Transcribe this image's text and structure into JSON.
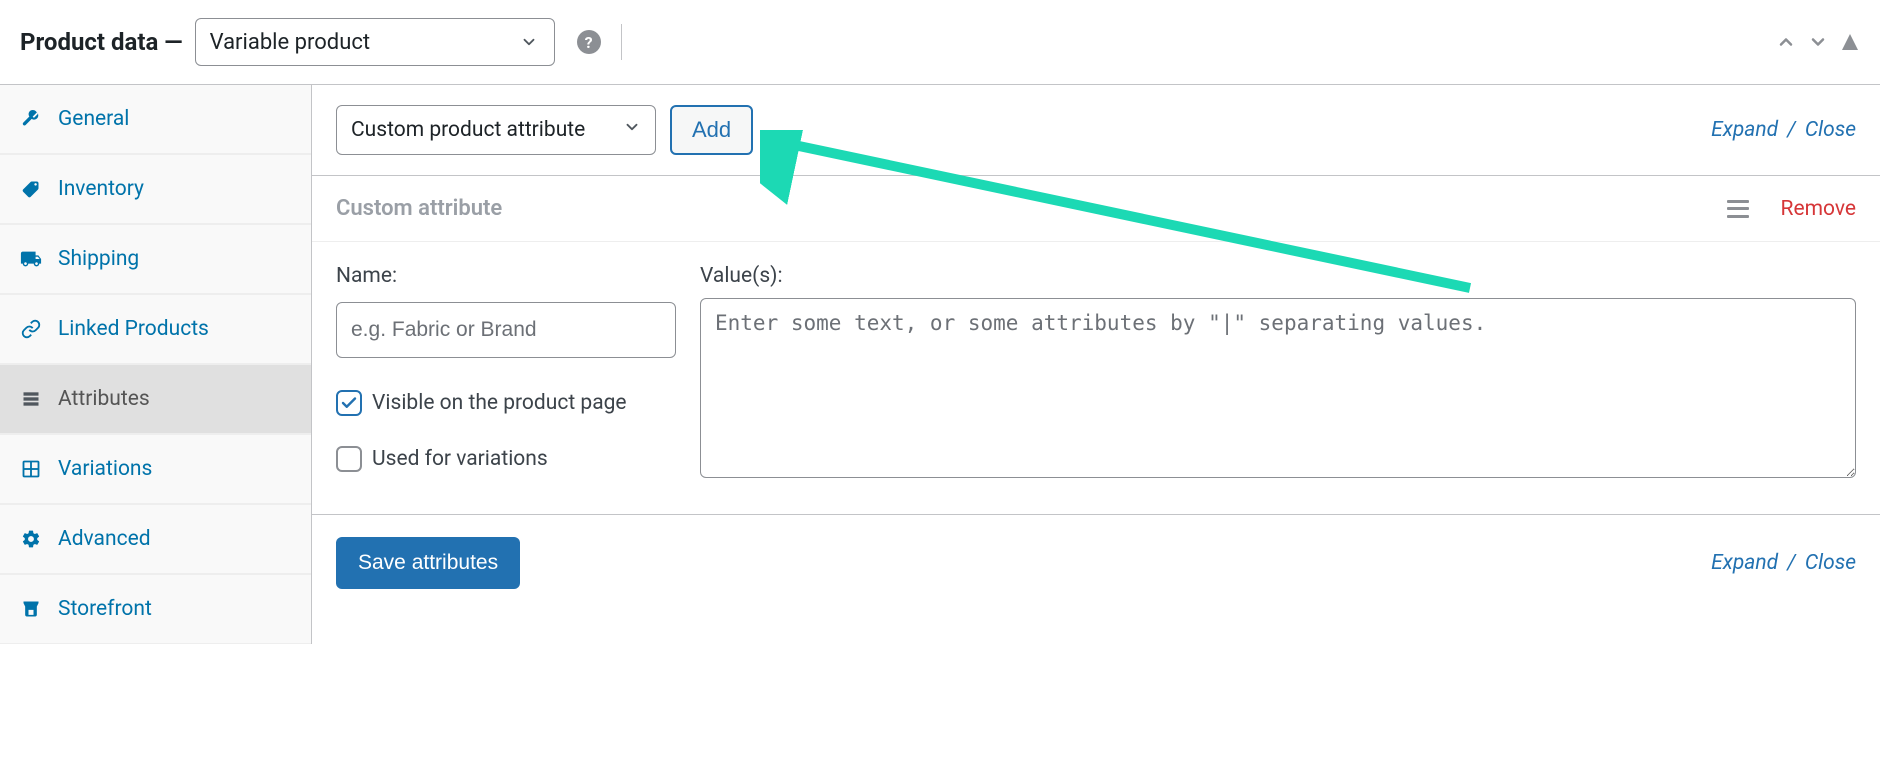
{
  "header": {
    "title": "Product data —",
    "product_type": "Variable product"
  },
  "sidebar": {
    "items": [
      {
        "label": "General",
        "icon": "wrench"
      },
      {
        "label": "Inventory",
        "icon": "tag"
      },
      {
        "label": "Shipping",
        "icon": "truck"
      },
      {
        "label": "Linked Products",
        "icon": "link"
      },
      {
        "label": "Attributes",
        "icon": "list",
        "active": true
      },
      {
        "label": "Variations",
        "icon": "grid"
      },
      {
        "label": "Advanced",
        "icon": "gear"
      },
      {
        "label": "Storefront",
        "icon": "store"
      }
    ]
  },
  "toolbar": {
    "attribute_select": "Custom product attribute",
    "add_label": "Add",
    "expand_label": "Expand",
    "close_label": "Close"
  },
  "attribute_panel": {
    "title": "Custom attribute",
    "remove_label": "Remove",
    "name_label": "Name:",
    "name_placeholder": "e.g. Fabric or Brand",
    "values_label": "Value(s):",
    "values_placeholder": "Enter some text, or some attributes by \"|\" separating values.",
    "visible_label": "Visible on the product page",
    "used_variations_label": "Used for variations"
  },
  "bottom": {
    "save_label": "Save attributes",
    "expand_label": "Expand",
    "close_label": "Close"
  },
  "colors": {
    "primary": "#2271b1",
    "danger": "#d63638",
    "annotation": "#1cd9b4"
  }
}
